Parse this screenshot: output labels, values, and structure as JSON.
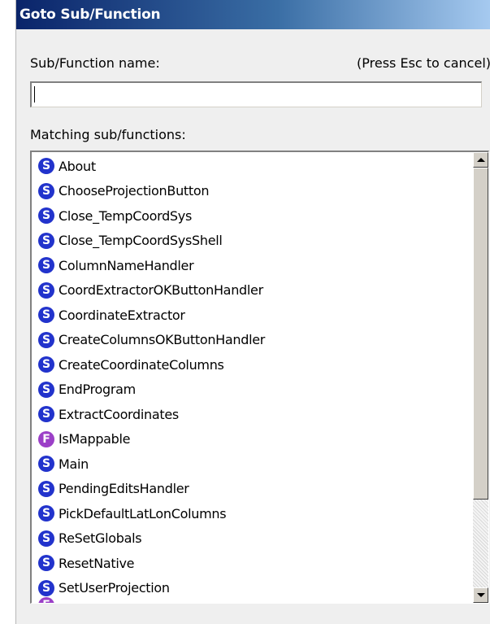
{
  "window": {
    "title": "Goto Sub/Function"
  },
  "form": {
    "name_label": "Sub/Function name:",
    "hint": "(Press Esc to cancel)",
    "name_value": "",
    "list_label": "Matching sub/functions:"
  },
  "icons": {
    "sub": {
      "name": "sub-icon",
      "glyph": "S",
      "color": "#2233cc"
    },
    "func": {
      "name": "function-icon",
      "glyph": "F",
      "color": "#9b3fc7"
    }
  },
  "items": [
    {
      "kind": "sub",
      "label": "About"
    },
    {
      "kind": "sub",
      "label": "ChooseProjectionButton"
    },
    {
      "kind": "sub",
      "label": "Close_TempCoordSys"
    },
    {
      "kind": "sub",
      "label": "Close_TempCoordSysShell"
    },
    {
      "kind": "sub",
      "label": "ColumnNameHandler"
    },
    {
      "kind": "sub",
      "label": "CoordExtractorOKButtonHandler"
    },
    {
      "kind": "sub",
      "label": "CoordinateExtractor"
    },
    {
      "kind": "sub",
      "label": "CreateColumnsOKButtonHandler"
    },
    {
      "kind": "sub",
      "label": "CreateCoordinateColumns"
    },
    {
      "kind": "sub",
      "label": "EndProgram"
    },
    {
      "kind": "sub",
      "label": "ExtractCoordinates"
    },
    {
      "kind": "func",
      "label": "IsMappable"
    },
    {
      "kind": "sub",
      "label": "Main"
    },
    {
      "kind": "sub",
      "label": "PendingEditsHandler"
    },
    {
      "kind": "sub",
      "label": "PickDefaultLatLonColumns"
    },
    {
      "kind": "sub",
      "label": "ReSetGlobals"
    },
    {
      "kind": "sub",
      "label": "ResetNative"
    },
    {
      "kind": "sub",
      "label": "SetUserProjection"
    }
  ],
  "scrollbar": {
    "position_fraction": 0.0
  }
}
